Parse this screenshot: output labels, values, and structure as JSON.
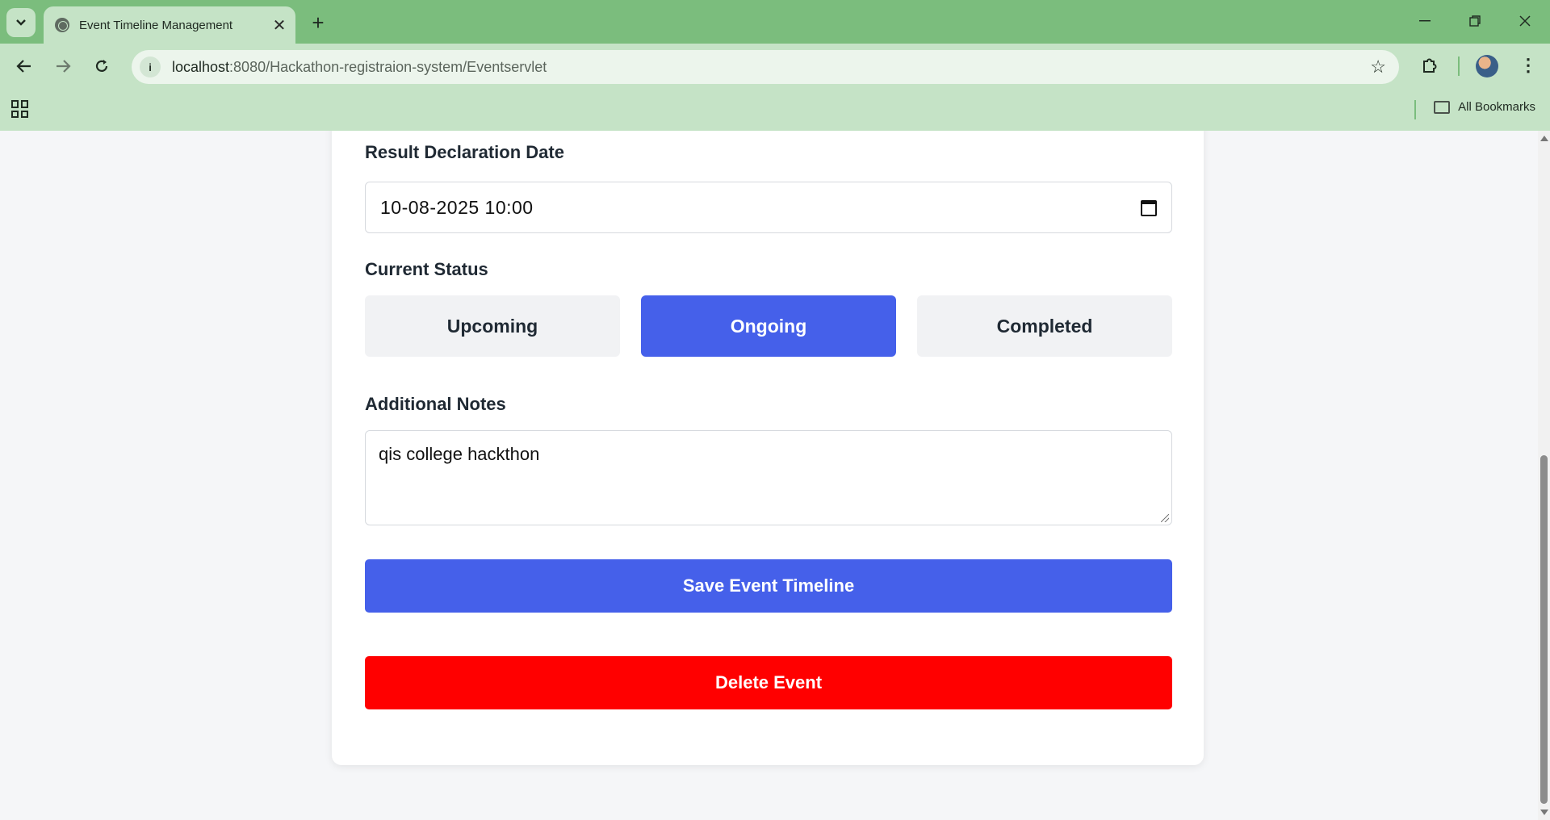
{
  "browser": {
    "tab_title": "Event Timeline Management",
    "url_host": "localhost",
    "url_rest": ":8080/Hackathon-registraion-system/Eventservlet",
    "bookmarks_label": "All Bookmarks",
    "new_tab": "+",
    "close_tab": "✕",
    "icons": [
      "tab-list-icon",
      "globe-icon",
      "close-icon",
      "plus-icon",
      "minimize-icon",
      "restore-icon",
      "window-close-icon",
      "back-icon",
      "forward-icon",
      "reload-icon",
      "info-icon",
      "star-icon",
      "extensions-icon",
      "profile-avatar",
      "more-menu-icon",
      "apps-icon",
      "folder-icon"
    ]
  },
  "form": {
    "result_date_label": "Result Declaration Date",
    "result_date_value": "10-08-2025 10:00",
    "status_label": "Current Status",
    "status_options": [
      "Upcoming",
      "Ongoing",
      "Completed"
    ],
    "selected_status": "Ongoing",
    "notes_label": "Additional Notes",
    "notes_value": "qis college hackthon",
    "save_label": "Save Event Timeline",
    "delete_label": "Delete Event"
  },
  "colors": {
    "primary": "#4560ea",
    "danger": "#ff0000",
    "chrome_dark": "#7bbd7d",
    "chrome_light": "#c5e3c6"
  }
}
